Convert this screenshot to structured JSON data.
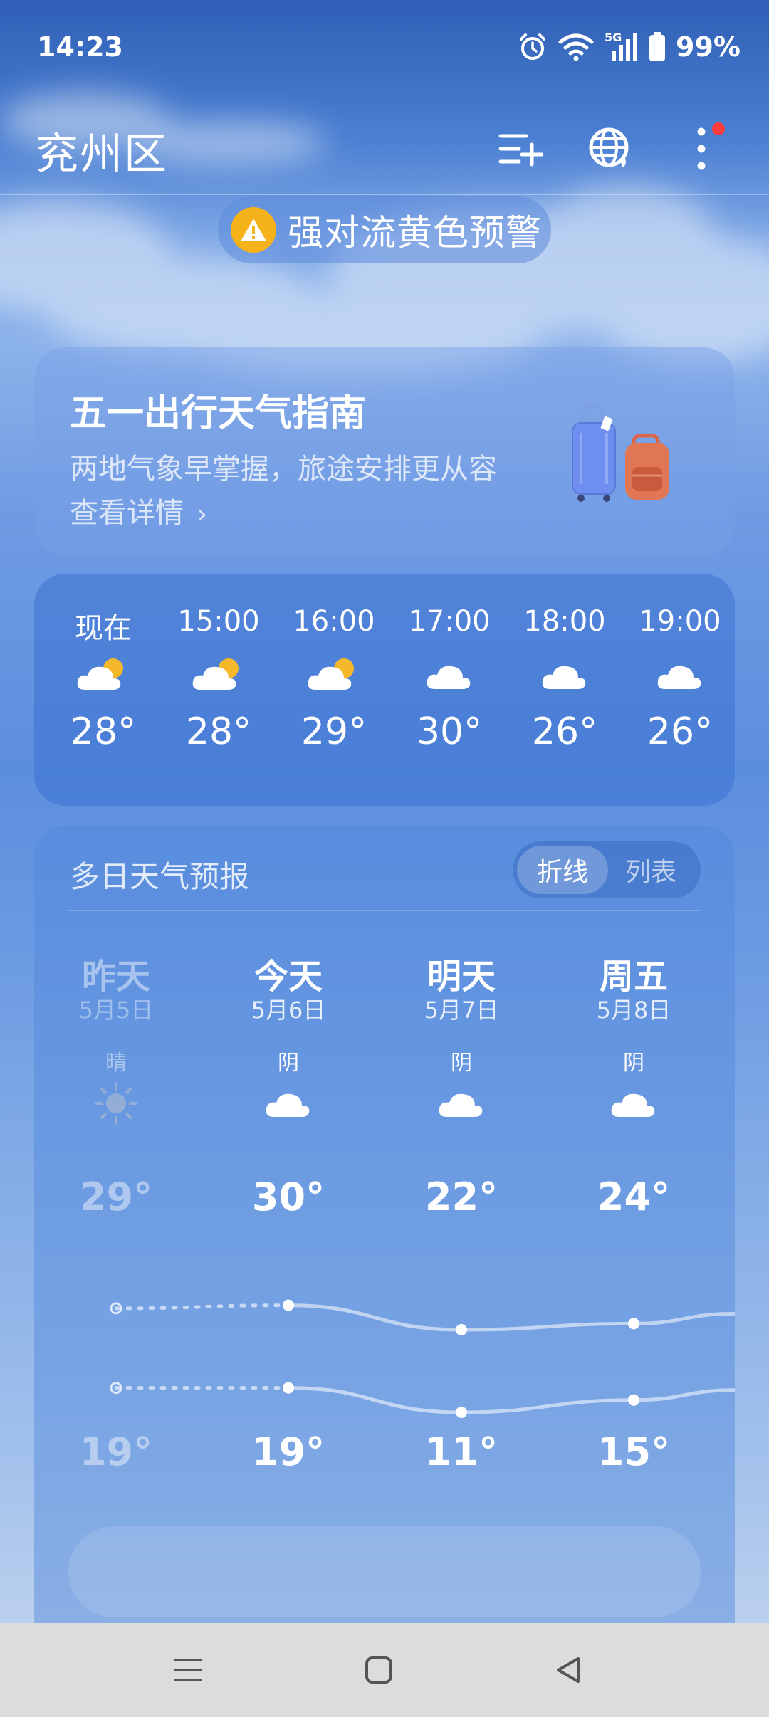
{
  "status_bar": {
    "time": "14:23",
    "network": "5G",
    "battery": "99%",
    "icons": [
      "alarm-icon",
      "wifi-icon",
      "cellular-signal-icon",
      "battery-icon"
    ]
  },
  "header": {
    "city": "兖州区",
    "buttons": [
      "add-city-icon",
      "globe-icon",
      "more-icon"
    ],
    "has_notification_dot": true
  },
  "alert": {
    "text": "强对流黄色预警",
    "color": "#f5b21a"
  },
  "guide_card": {
    "title": "五一出行天气指南",
    "subtitle": "两地气象早掌握，旅途安排更从容",
    "link": "查看详情"
  },
  "hourly": [
    {
      "time": "现在",
      "icon": "partly-cloudy-icon",
      "temp": "28°"
    },
    {
      "time": "15:00",
      "icon": "partly-cloudy-icon",
      "temp": "28°"
    },
    {
      "time": "16:00",
      "icon": "partly-cloudy-icon",
      "temp": "29°"
    },
    {
      "time": "17:00",
      "icon": "cloudy-icon",
      "temp": "30°"
    },
    {
      "time": "18:00",
      "icon": "cloudy-icon",
      "temp": "26°"
    },
    {
      "time": "19:00",
      "icon": "cloudy-icon",
      "temp": "26°"
    }
  ],
  "forecast": {
    "title": "多日天气预报",
    "toggle": {
      "active": "折线",
      "inactive": "列表"
    },
    "days": [
      {
        "name": "昨天",
        "date": "5月5日",
        "cond": "晴",
        "icon": "sunny-icon",
        "high": "29°",
        "low": "19°",
        "high_value": 29,
        "low_value": 19,
        "past": true
      },
      {
        "name": "今天",
        "date": "5月6日",
        "cond": "阴",
        "icon": "cloudy-icon",
        "high": "30°",
        "low": "19°",
        "high_value": 30,
        "low_value": 19,
        "past": false
      },
      {
        "name": "明天",
        "date": "5月7日",
        "cond": "阴",
        "icon": "cloudy-icon",
        "high": "22°",
        "low": "11°",
        "high_value": 22,
        "low_value": 11,
        "past": false
      },
      {
        "name": "周五",
        "date": "5月8日",
        "cond": "阴",
        "icon": "cloudy-icon",
        "high": "24°",
        "low": "15°",
        "high_value": 24,
        "low_value": 15,
        "past": false
      }
    ]
  },
  "nav_bar": {
    "buttons": [
      "menu-icon",
      "home-icon",
      "back-icon"
    ],
    "background": "#dcdcde"
  }
}
